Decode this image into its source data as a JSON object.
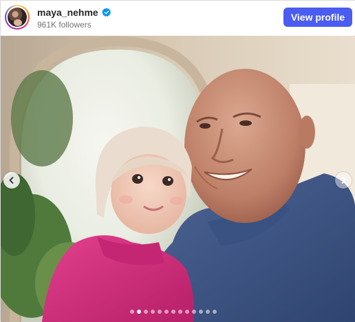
{
  "account": {
    "username": "maya_nehme",
    "followers": "961K followers",
    "verified": true
  },
  "actions": {
    "view_profile_label": "View profile"
  },
  "carousel": {
    "slide_count": 13,
    "active_index": 1
  },
  "colors": {
    "button": "#4a5cf1",
    "verified_badge": "#0095f6",
    "hoodie_pink": "#d1277a",
    "sweater_blue": "#3f5583"
  },
  "icons": {
    "verified": "verified-badge-icon",
    "prev": "chevron-left-icon",
    "next": "chevron-right-icon"
  }
}
